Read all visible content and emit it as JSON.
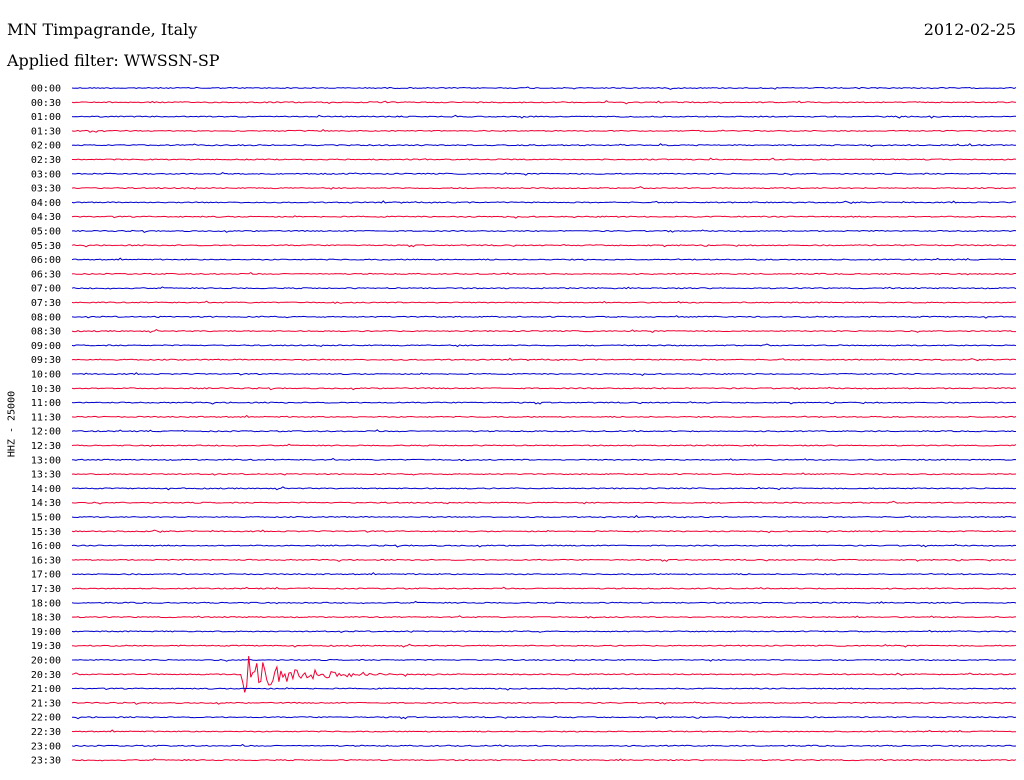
{
  "header": {
    "station": "MN Timpagrande, Italy",
    "filter_label": "Applied filter: WWSSN-SP",
    "date": "2012-02-25"
  },
  "colors": {
    "trace_a": "#0000cc",
    "trace_b": "#ee0033",
    "text": "#000000"
  },
  "chart_data": {
    "type": "line",
    "title": "MN Timpagrande, Italy",
    "subtitle": "Applied filter: WWSSN-SP",
    "ylabel": "HHZ - 25000",
    "xlabel": "",
    "grid": false,
    "rows": [
      {
        "label": "00:00",
        "series": "a"
      },
      {
        "label": "00:30",
        "series": "b"
      },
      {
        "label": "01:00",
        "series": "a"
      },
      {
        "label": "01:30",
        "series": "b"
      },
      {
        "label": "02:00",
        "series": "a"
      },
      {
        "label": "02:30",
        "series": "b"
      },
      {
        "label": "03:00",
        "series": "a"
      },
      {
        "label": "03:30",
        "series": "b"
      },
      {
        "label": "04:00",
        "series": "a"
      },
      {
        "label": "04:30",
        "series": "b"
      },
      {
        "label": "05:00",
        "series": "a"
      },
      {
        "label": "05:30",
        "series": "b"
      },
      {
        "label": "06:00",
        "series": "a"
      },
      {
        "label": "06:30",
        "series": "b"
      },
      {
        "label": "07:00",
        "series": "a"
      },
      {
        "label": "07:30",
        "series": "b"
      },
      {
        "label": "08:00",
        "series": "a"
      },
      {
        "label": "08:30",
        "series": "b"
      },
      {
        "label": "09:00",
        "series": "a"
      },
      {
        "label": "09:30",
        "series": "b"
      },
      {
        "label": "10:00",
        "series": "a"
      },
      {
        "label": "10:30",
        "series": "b"
      },
      {
        "label": "11:00",
        "series": "a"
      },
      {
        "label": "11:30",
        "series": "b"
      },
      {
        "label": "12:00",
        "series": "a"
      },
      {
        "label": "12:30",
        "series": "b"
      },
      {
        "label": "13:00",
        "series": "a"
      },
      {
        "label": "13:30",
        "series": "b"
      },
      {
        "label": "14:00",
        "series": "a"
      },
      {
        "label": "14:30",
        "series": "b"
      },
      {
        "label": "15:00",
        "series": "a"
      },
      {
        "label": "15:30",
        "series": "b"
      },
      {
        "label": "16:00",
        "series": "a"
      },
      {
        "label": "16:30",
        "series": "b"
      },
      {
        "label": "17:00",
        "series": "a"
      },
      {
        "label": "17:30",
        "series": "b"
      },
      {
        "label": "18:00",
        "series": "a"
      },
      {
        "label": "18:30",
        "series": "b"
      },
      {
        "label": "19:00",
        "series": "a"
      },
      {
        "label": "19:30",
        "series": "b"
      },
      {
        "label": "20:00",
        "series": "a"
      },
      {
        "label": "20:30",
        "series": "b"
      },
      {
        "label": "21:00",
        "series": "a"
      },
      {
        "label": "21:30",
        "series": "b"
      },
      {
        "label": "22:00",
        "series": "a"
      },
      {
        "label": "22:30",
        "series": "b"
      },
      {
        "label": "23:00",
        "series": "a"
      },
      {
        "label": "23:30",
        "series": "b"
      }
    ],
    "events": [
      {
        "row": "20:30",
        "minute_offset": 5.4,
        "amplitude": "large",
        "decay_minutes": 3.2
      }
    ]
  }
}
